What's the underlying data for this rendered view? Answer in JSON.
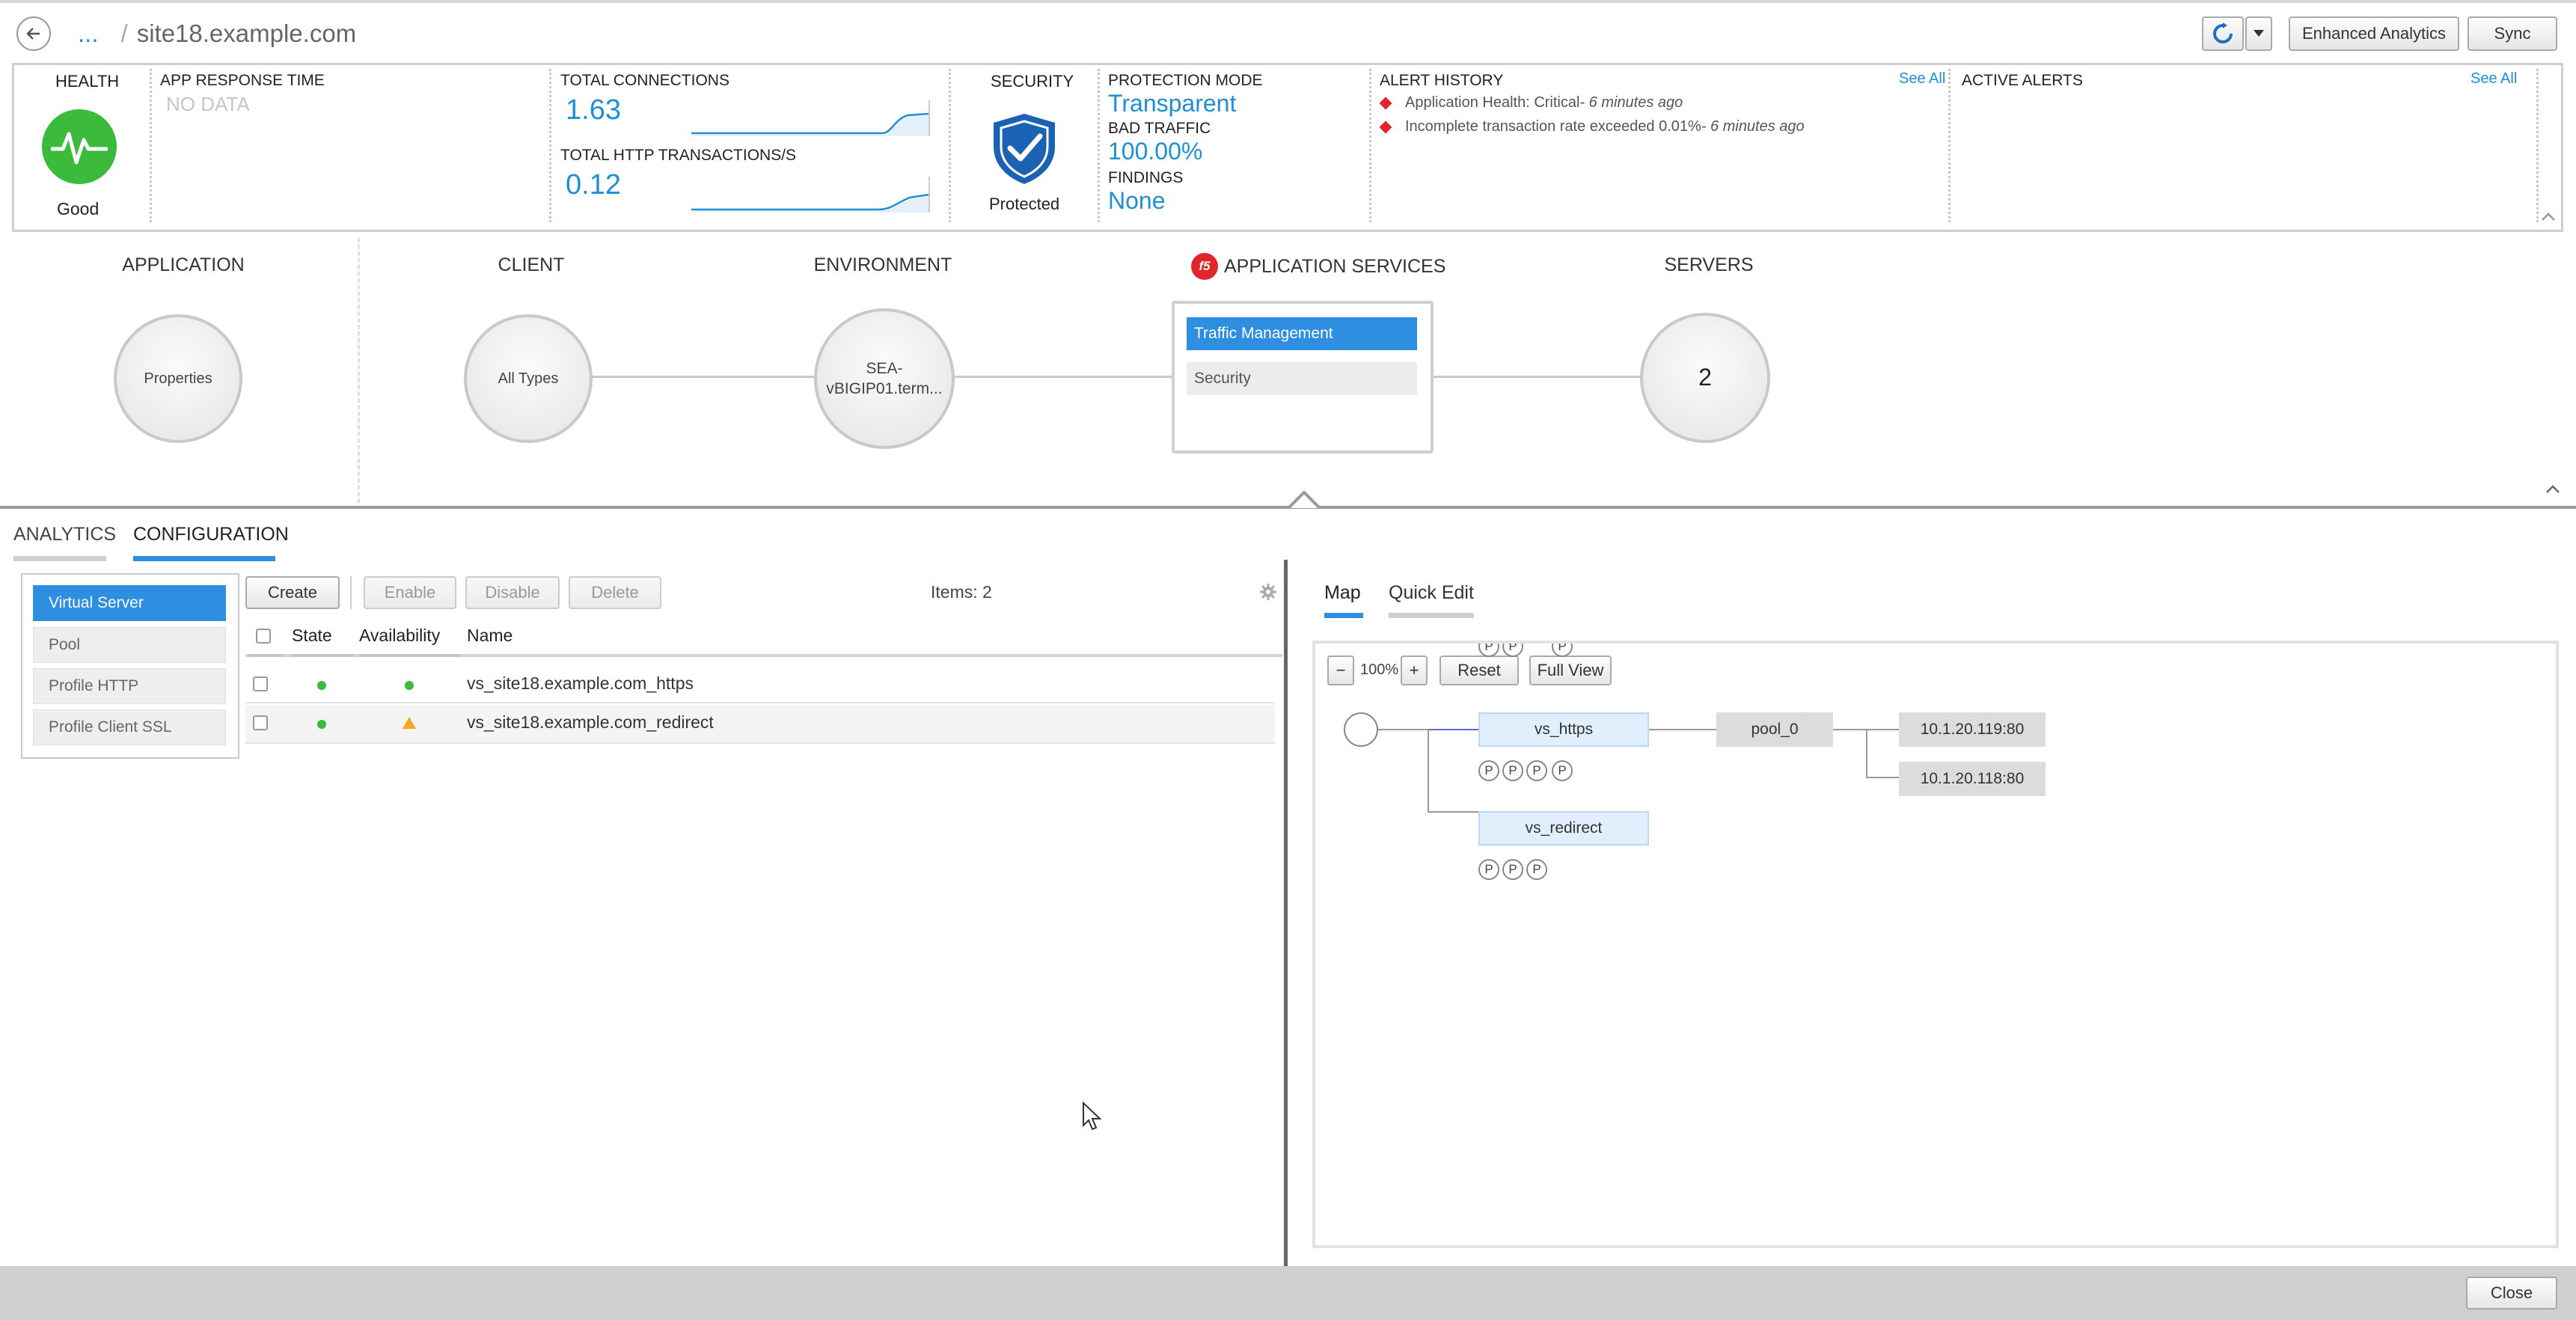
{
  "header": {
    "breadcrumb_ellipsis": "...",
    "breadcrumb_sep": "/",
    "title": "site18.example.com",
    "enhanced_analytics": "Enhanced Analytics",
    "sync": "Sync"
  },
  "summary": {
    "health_label": "HEALTH",
    "health_status": "Good",
    "app_response_label": "APP RESPONSE TIME",
    "app_response_value": "NO DATA",
    "total_connections_label": "TOTAL CONNECTIONS",
    "total_connections_value": "1.63",
    "total_http_label": "TOTAL HTTP TRANSACTIONS/s",
    "total_http_value": "0.12",
    "security_label": "SECURITY",
    "security_status": "Protected",
    "protection_mode_label": "PROTECTION MODE",
    "protection_mode_value": "Transparent",
    "bad_traffic_label": "BAD TRAFFIC",
    "bad_traffic_value": "100.00%",
    "findings_label": "FINDINGS",
    "findings_value": "None",
    "alert_history_label": "ALERT HISTORY",
    "see_all": "See All",
    "alerts": [
      {
        "text": "Application Health: Critical",
        "time": " - 6 minutes ago"
      },
      {
        "text": "Incomplete transaction rate exceeded 0.01%",
        "time": " - 6 minutes ago"
      }
    ],
    "active_alerts_label": "ACTIVE ALERTS",
    "active_see_all": "See All"
  },
  "flow": {
    "application_label": "APPLICATION",
    "application_node": "Properties",
    "client_label": "CLIENT",
    "client_node": "All Types",
    "environment_label": "ENVIRONMENT",
    "environment_node_line1": "SEA-",
    "environment_node_line2": "vBIGIP01.term...",
    "app_services_label": "APPLICATION SERVICES",
    "traffic_management": "Traffic Management",
    "security": "Security",
    "servers_label": "SERVERS",
    "servers_count": "2"
  },
  "tabs": {
    "analytics": "ANALYTICS",
    "configuration": "CONFIGURATION"
  },
  "sidebar": {
    "items": [
      {
        "label": "Virtual Server"
      },
      {
        "label": "Pool"
      },
      {
        "label": "Profile HTTP"
      },
      {
        "label": "Profile Client SSL"
      }
    ]
  },
  "toolbar": {
    "create": "Create",
    "enable": "Enable",
    "disable": "Disable",
    "delete": "Delete",
    "items_count": "Items: 2"
  },
  "table": {
    "headers": {
      "state": "State",
      "availability": "Availability",
      "name": "Name"
    },
    "rows": [
      {
        "name": "vs_site18.example.com_https",
        "availability": "green"
      },
      {
        "name": "vs_site18.example.com_redirect",
        "availability": "warning"
      }
    ]
  },
  "map": {
    "tab_map": "Map",
    "tab_quick_edit": "Quick Edit",
    "zoom_minus": "−",
    "zoom_level": "100%",
    "zoom_plus": "+",
    "reset": "Reset",
    "full_view": "Full View",
    "vs_https": "vs_https",
    "vs_redirect": "vs_redirect",
    "pool": "pool_0",
    "member1": "10.1.20.119:80",
    "member2": "10.1.20.118:80",
    "badge": "P"
  },
  "footer": {
    "close": "Close"
  },
  "colors": {
    "accent": "#2e8ee0",
    "metric": "#1f8fd4",
    "health_green": "#3cba3c",
    "alert_red": "#e0262b",
    "warning_orange": "#f5a623"
  }
}
